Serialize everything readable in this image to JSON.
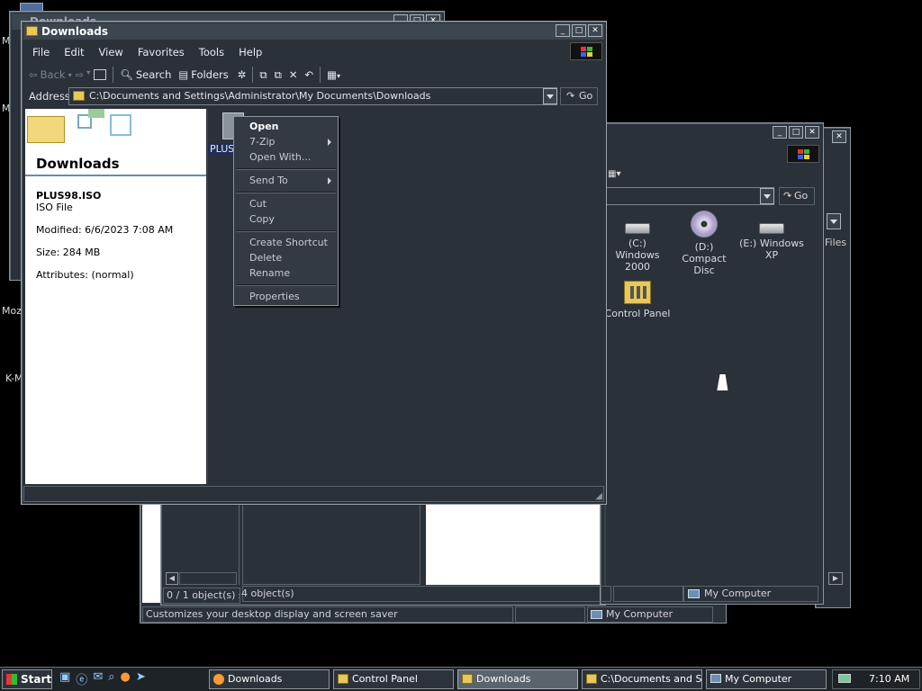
{
  "desktop_fragments": [
    "M",
    "M",
    "Moz",
    "K-M",
    "Downloads"
  ],
  "back_window": {
    "status_text": "Customizes your desktop display and screen saver",
    "status_computer": "My Computer"
  },
  "mycomputer_window": {
    "status_count": "4 object(s)",
    "status_location": "My Computer",
    "drives": [
      {
        "label": "(C:) Windows 2000",
        "icon": "hard-drive-icon"
      },
      {
        "label": "(D:) Compact Disc",
        "icon": "cd-drive-icon"
      },
      {
        "label": "(E:) Windows XP",
        "icon": "hard-drive-icon"
      },
      {
        "label": "Control Panel",
        "icon": "control-panel-icon"
      }
    ],
    "files_fragment": "Files",
    "go_label": "Go"
  },
  "middle_window": {
    "status_text": "0 / 1 object(s) se"
  },
  "main_window": {
    "title": "Downloads",
    "menu": [
      "File",
      "Edit",
      "View",
      "Favorites",
      "Tools",
      "Help"
    ],
    "toolbar": {
      "back": "Back",
      "search": "Search",
      "folders": "Folders"
    },
    "address_label": "Address",
    "address_value": "C:\\Documents and Settings\\Administrator\\My Documents\\Downloads",
    "go_label": "Go",
    "sidebar": {
      "folder_title": "Downloads",
      "file_name": "PLUS98.ISO",
      "file_type": "ISO File",
      "modified": "Modified: 6/6/2023 7:08 AM",
      "size": "Size: 284 MB",
      "attributes": "Attributes: (normal)"
    },
    "selected_file_label": "PLUS9"
  },
  "context_menu": {
    "open": "Open",
    "seven_zip": "7-Zip",
    "open_with": "Open With...",
    "send_to": "Send To",
    "cut": "Cut",
    "copy": "Copy",
    "create_shortcut": "Create Shortcut",
    "delete": "Delete",
    "rename": "Rename",
    "properties": "Properties"
  },
  "taskbar": {
    "start": "Start",
    "tasks": [
      {
        "label": "Downloads",
        "active": false
      },
      {
        "label": "Control Panel",
        "active": false
      },
      {
        "label": "Downloads",
        "active": true
      },
      {
        "label": "C:\\Documents and S...",
        "active": false
      },
      {
        "label": "My Computer",
        "active": false
      }
    ],
    "clock": "7:10 AM"
  },
  "colors": {
    "accent": "#3c4650",
    "window_bg": "#2b3138",
    "active_task": "#5a646c"
  }
}
